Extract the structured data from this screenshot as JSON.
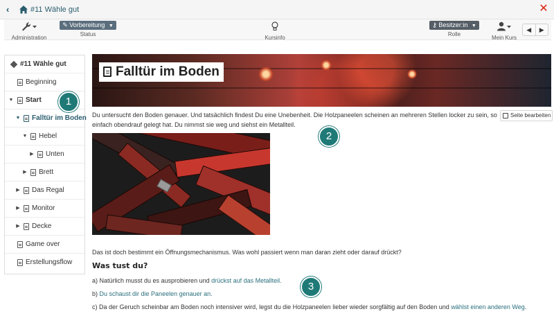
{
  "topbar": {
    "course_title": "#11 Wähle gut"
  },
  "toolbar": {
    "administration_label": "Administration",
    "status_value": "Vorbereitung",
    "status_label": "Status",
    "kursinfo_label": "Kursinfo",
    "role_value": "Besitzer:in",
    "role_label": "Rolle",
    "mycourse_label": "Mein Kurs"
  },
  "menu": {
    "items": [
      {
        "label": "#11 Wähle gut"
      },
      {
        "label": "Beginning"
      },
      {
        "label": "Start"
      },
      {
        "label": "Falltür im Boden"
      },
      {
        "label": "Hebel"
      },
      {
        "label": "Unten"
      },
      {
        "label": "Brett"
      },
      {
        "label": "Das Regal"
      },
      {
        "label": "Monitor"
      },
      {
        "label": "Decke"
      },
      {
        "label": "Game over"
      },
      {
        "label": "Erstellungsflow"
      }
    ]
  },
  "page": {
    "title": "Falltür im Boden",
    "edit_button": "Seite bearbeiten",
    "intro_line1": "Du untersucht den Boden genauer. Und tatsächlich findest Du eine Unebenheit. Die Holzpaneelen scheinen an mehreren Stellen locker zu sein, so a",
    "intro_line2": "einfach obendrauf gelegt hat. Du nimmst sie weg und  siehst ein Metallteil.",
    "question_text": "Das ist doch bestimmt ein Öffnungsmechanismus. Was wohl passiert wenn man daran zieht oder darauf drückt?",
    "heading": "Was tust du?",
    "option_a_prefix": "a) Natürlich musst du es ausprobieren und ",
    "option_a_link": "drückst auf das Metallteil.",
    "option_b_prefix": "b) ",
    "option_b_link": "Du schaust dir die Paneelen genauer an.",
    "option_c_prefix": "c) Da der Geruch scheinbar am Boden noch intensiver wird, legst du die Holzpaneelen lieber wieder sorgfältig auf den Boden und ",
    "option_c_link": "wählst einen anderen Weg",
    "option_c_suffix": "."
  },
  "badges": [
    "1",
    "2",
    "3"
  ],
  "colors": {
    "accent": "#2a5d6e",
    "close": "#d9230f",
    "badge": "#1f7a77",
    "link": "#2a6f7d"
  }
}
